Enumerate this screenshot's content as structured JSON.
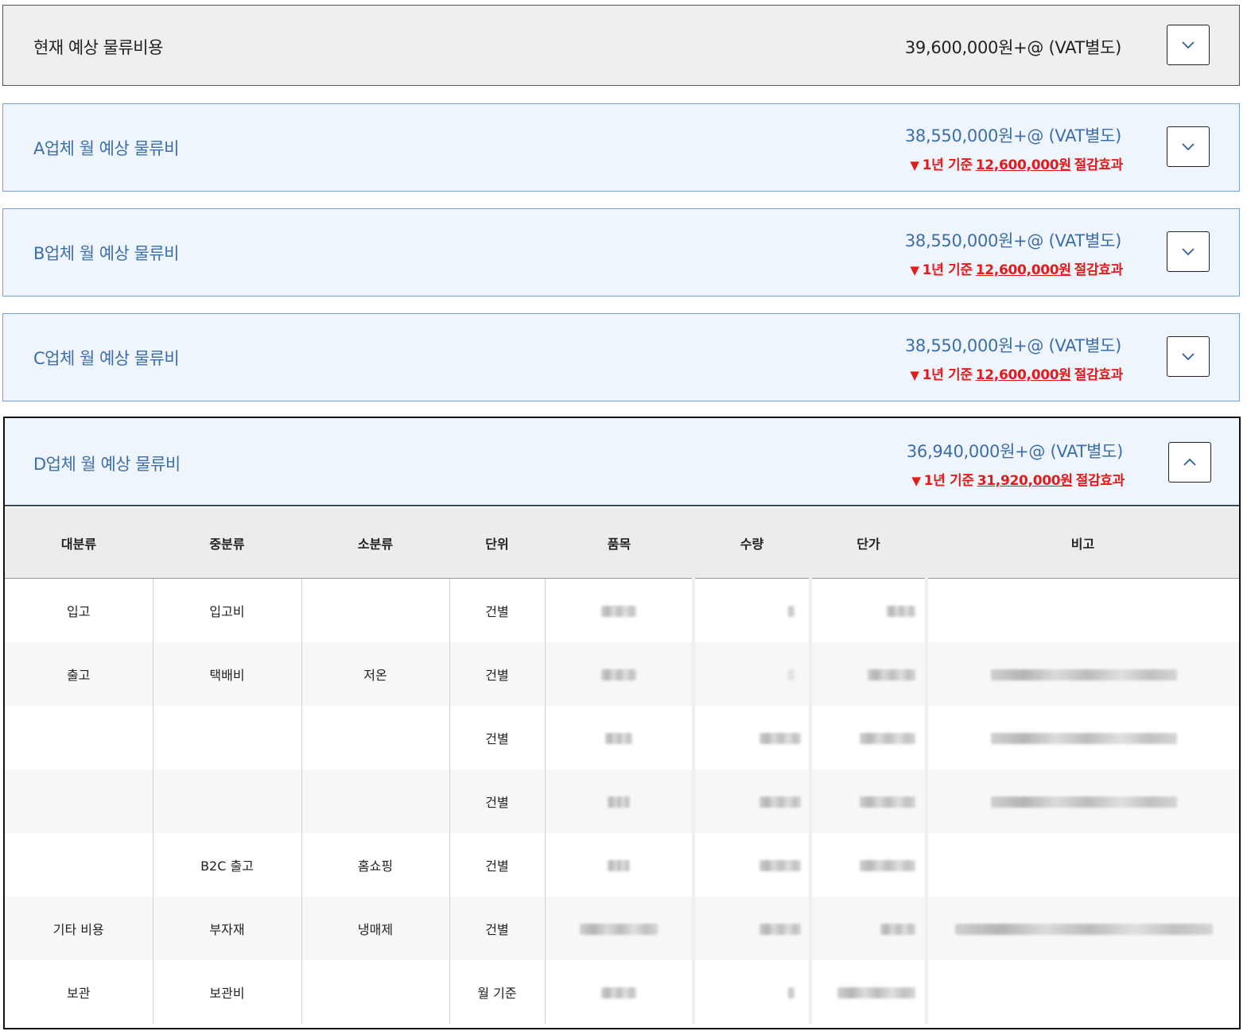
{
  "current": {
    "title": "현재 예상 물류비용",
    "amount": "39,600,000원+@ (VAT별도)"
  },
  "vendors": [
    {
      "title": "A업체 월 예상 물류비",
      "amount": "38,550,000원+@ (VAT별도)",
      "saving_prefix": "1년 기준",
      "saving_amount": "12,600,000원",
      "saving_suffix": "절감효과",
      "expanded": false
    },
    {
      "title": "B업체 월 예상 물류비",
      "amount": "38,550,000원+@ (VAT별도)",
      "saving_prefix": "1년 기준",
      "saving_amount": "12,600,000원",
      "saving_suffix": "절감효과",
      "expanded": false
    },
    {
      "title": "C업체 월 예상 물류비",
      "amount": "38,550,000원+@ (VAT별도)",
      "saving_prefix": "1년 기준",
      "saving_amount": "12,600,000원",
      "saving_suffix": "절감효과",
      "expanded": false
    },
    {
      "title": "D업체 월 예상 물류비",
      "amount": "36,940,000원+@ (VAT별도)",
      "saving_prefix": "1년 기준",
      "saving_amount": "31,920,000원",
      "saving_suffix": "절감효과",
      "expanded": true
    }
  ],
  "colors": {
    "vendor_text": "#3e6ea9",
    "vendor_bg": "#eef5fd",
    "saving_red": "#e41b1b",
    "current_bg": "#efefef"
  },
  "icons": {
    "collapsed": "chevron-down-icon",
    "expanded": "chevron-up-icon",
    "saving": "triangle-down-icon"
  },
  "table": {
    "headers": [
      "대분류",
      "중분류",
      "소분류",
      "단위",
      "품목",
      "수량",
      "단가",
      "비고"
    ],
    "rows": [
      [
        "입고",
        "입고비",
        "",
        "건별"
      ],
      [
        "출고",
        "택배비",
        "저온",
        "건별"
      ],
      [
        "",
        "",
        "",
        "건별"
      ],
      [
        "",
        "",
        "",
        "건별"
      ],
      [
        "",
        "B2C 출고",
        "홈쇼핑",
        "건별"
      ],
      [
        "기타 비용",
        "부자재",
        "냉매제",
        "건별"
      ],
      [
        "보관",
        "보관비",
        "",
        "월 기준"
      ]
    ],
    "redacted_note": "품목, 수량, 단가, 비고 values are blurred in the screenshot"
  }
}
